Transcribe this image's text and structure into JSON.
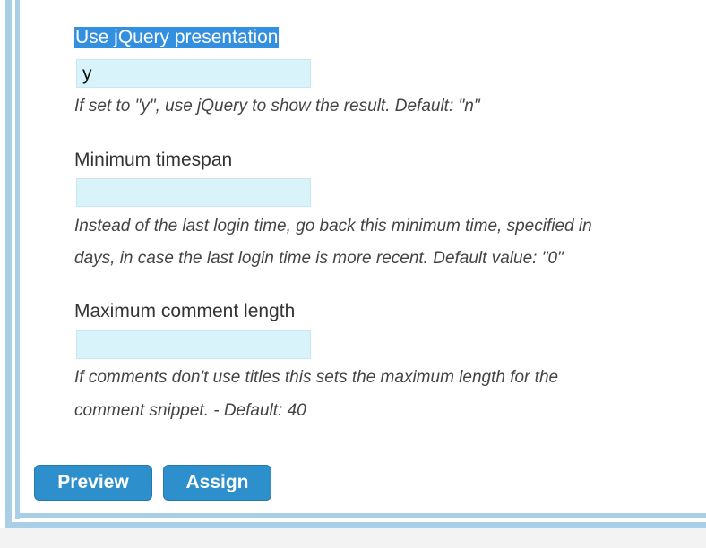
{
  "form": {
    "fields": [
      {
        "label": "Use jQuery presentation",
        "value": "y",
        "help": "If set to \"y\", use jQuery to show the result. Default: \"n\""
      },
      {
        "label": "Minimum timespan",
        "value": "",
        "help_line1": "Instead of the last login time, go back this minimum time, specified in",
        "help_line2": "days, in case the last login time is more recent. Default value: \"0\""
      },
      {
        "label": "Maximum comment length",
        "value": "",
        "help_line1": "If comments don't use titles this sets the maximum length for the",
        "help_line2": "comment snippet. - Default: 40"
      }
    ]
  },
  "buttons": {
    "preview": "Preview",
    "assign": "Assign"
  },
  "colors": {
    "accent": "#2d8fcc",
    "field_bg": "#d9f3fb",
    "frame": "#a9cfe6",
    "selection": "#3390e0"
  }
}
